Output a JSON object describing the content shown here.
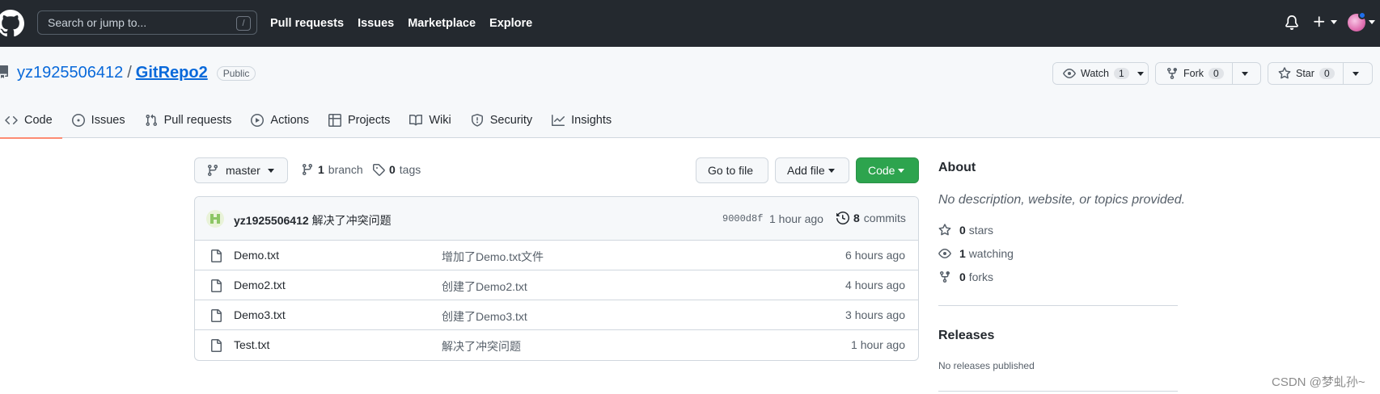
{
  "header": {
    "search_placeholder": "Search or jump to...",
    "slash_key": "/",
    "nav": [
      "Pull requests",
      "Issues",
      "Marketplace",
      "Explore"
    ]
  },
  "repo": {
    "owner": "yz1925506412",
    "separator": "/",
    "name": "GitRepo2",
    "visibility": "Public",
    "watch_label": "Watch",
    "watch_count": "1",
    "fork_label": "Fork",
    "fork_count": "0",
    "star_label": "Star",
    "star_count": "0"
  },
  "tabs": [
    "Code",
    "Issues",
    "Pull requests",
    "Actions",
    "Projects",
    "Wiki",
    "Security",
    "Insights"
  ],
  "toolbar": {
    "branch": "master",
    "branch_count": "1",
    "branch_label": "branch",
    "tag_count": "0",
    "tag_label": "tags",
    "go_to_file": "Go to file",
    "add_file": "Add file",
    "code": "Code"
  },
  "latest_commit": {
    "author": "yz1925506412",
    "message": "解决了冲突问题",
    "sha": "9000d8f",
    "time": "1 hour ago",
    "commit_count": "8",
    "commit_label": "commits"
  },
  "files": [
    {
      "name": "Demo.txt",
      "message": "增加了Demo.txt文件",
      "time": "6 hours ago"
    },
    {
      "name": "Demo2.txt",
      "message": "创建了Demo2.txt",
      "time": "4 hours ago"
    },
    {
      "name": "Demo3.txt",
      "message": "创建了Demo3.txt",
      "time": "3 hours ago"
    },
    {
      "name": "Test.txt",
      "message": "解决了冲突问题",
      "time": "1 hour ago"
    }
  ],
  "about": {
    "title": "About",
    "description": "No description, website, or topics provided.",
    "stars_count": "0",
    "stars_label": "stars",
    "watching_count": "1",
    "watching_label": "watching",
    "forks_count": "0",
    "forks_label": "forks"
  },
  "releases": {
    "title": "Releases",
    "description": "No releases published"
  },
  "watermark": "CSDN @梦虬孙~",
  "colors": {
    "header_bg": "#24292f",
    "link": "#0969da",
    "green": "#2da44e",
    "tab_underline": "#fd8c73"
  }
}
